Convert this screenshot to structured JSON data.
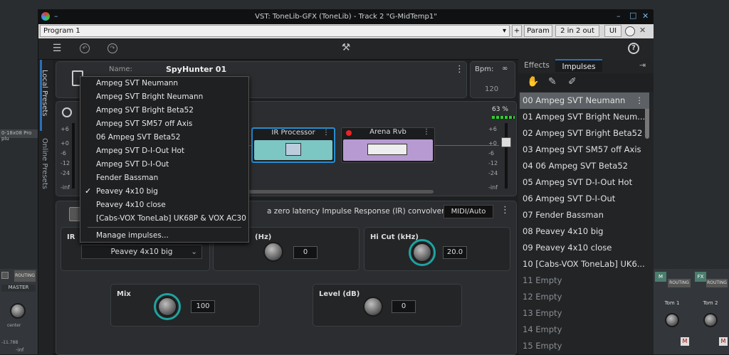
{
  "window": {
    "title": "VST: ToneLib-GFX (ToneLib) - Track 2 \"G-MidTemp1\"",
    "min_glyph": "–",
    "max_glyph": "□",
    "close_glyph": "✕"
  },
  "toolbar": {
    "program": "Program 1",
    "plus": "+",
    "param": "Param",
    "io": "2 in 2 out",
    "ui": "UI"
  },
  "side_tabs": {
    "local": "Local Presets",
    "online": "Online Presets"
  },
  "preset": {
    "name_label": "Name:",
    "name": "SpyHunter 01"
  },
  "bpm": {
    "label": "Bpm:",
    "value": "120"
  },
  "meter": {
    "percent": "63 %",
    "ticks": [
      "+6",
      "+0",
      "-6",
      "-12",
      "-24",
      "-inf"
    ],
    "ticks_left": [
      "+6",
      "+0",
      "-6",
      "-12",
      "-24",
      "-inf"
    ]
  },
  "chain": [
    {
      "name": "IR Processor"
    },
    {
      "name": "Arena Rvb"
    }
  ],
  "ir_panel": {
    "description": "a zero latency Impulse Response (IR) convolver.",
    "midi_auto": "MIDI/Auto",
    "ir_label": "IR",
    "ir_select": "Peavey 4x10 big",
    "lowcut_label": "(Hz)",
    "lowcut_value": "0",
    "hicut_label": "Hi Cut (kHz)",
    "hicut_value": "20.0",
    "mix_label": "Mix",
    "mix_value": "100",
    "level_label": "Level (dB)",
    "level_value": "0"
  },
  "dropdown": {
    "items": [
      "Ampeg SVT Neumann",
      "Ampeg SVT Bright Neumann",
      "Ampeg SVT Bright Beta52",
      "Ampeg SVT SM57 off Axis",
      "06 Ampeg SVT Beta52",
      "Ampeg SVT D-I-Out Hot",
      "Ampeg SVT D-I-Out",
      "Fender Bassman",
      "Peavey 4x10 big",
      "Peavey 4x10 close",
      "[Cabs-VOX ToneLab] UK68P & VOX AC30"
    ],
    "checked_index": 8,
    "check_glyph": "✓",
    "manage": "Manage impulses..."
  },
  "right_panel": {
    "tabs": [
      "Effects",
      "Impulses"
    ],
    "active_tab": 1,
    "items": [
      "00 Ampeg SVT Neumann",
      "01 Ampeg SVT Bright Neum...",
      "02 Ampeg SVT Bright Beta52",
      "03 Ampeg SVT SM57 off Axis",
      "04 06 Ampeg SVT Beta52",
      "05 Ampeg SVT D-I-Out Hot",
      "06 Ampeg SVT D-I-Out",
      "07 Fender Bassman",
      "08 Peavey 4x10 big",
      "09 Peavey 4x10 close",
      "10 [Cabs-VOX ToneLab] UK6...",
      "11 Empty",
      "12 Empty",
      "13 Empty",
      "14 Empty",
      "15 Empty"
    ],
    "selected_index": 0,
    "empty_from": 11
  },
  "daw": {
    "left_track_label": "MASTER",
    "left_tag": "0-18x08 Pro plu",
    "routing": "ROUTING",
    "fx": "FX",
    "m": "M",
    "center": "center",
    "right_tracks": [
      "Tom 1",
      "Tom 2"
    ],
    "left_db": "-11.78B",
    "left_inf": "-inf"
  },
  "colors": {
    "accent_teal": "#1fa3a0",
    "ir_block": "#7cc6c4",
    "rvb_block": "#b79ad1",
    "selected_tab": "#2a6fb5"
  }
}
